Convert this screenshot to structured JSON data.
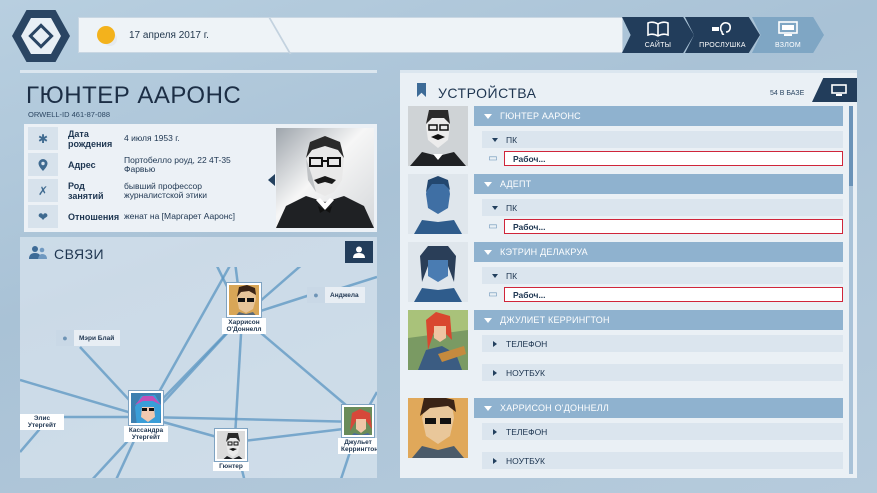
{
  "topbar": {
    "date": "17 апреля 2017 г.",
    "nav": [
      {
        "label": "САЙТЫ",
        "icon": "book-icon"
      },
      {
        "label": "ПРОСЛУШКА",
        "icon": "ear-icon"
      },
      {
        "label": "ВЗЛОМ",
        "icon": "computer-icon"
      }
    ]
  },
  "profile": {
    "name": "ГЮНТЕР ААРОНС",
    "orwell_id": "ORWELL-ID  461-87-088",
    "rows": [
      {
        "label": "Дата рождения",
        "value": "4 июля 1953 г."
      },
      {
        "label": "Адрес",
        "value": "Портобелло роуд, 22 4T-35 Фарвью"
      },
      {
        "label": "Род занятий",
        "value": "бывший профессор журналистской этики"
      },
      {
        "label": "Отношения",
        "value": "женат на [Маргарет Ааронс]"
      }
    ]
  },
  "links": {
    "title": "СВЯЗИ",
    "nodes": [
      {
        "name": "Харрисон О'Доннелл"
      },
      {
        "name": "Кассандра Утергейт"
      },
      {
        "name": "Гюнтер"
      },
      {
        "name": "Джульет Керрингтон"
      }
    ],
    "tags": [
      {
        "name": "Анджела"
      },
      {
        "name": "Мэри Блай"
      },
      {
        "name": "Элис Утергейт"
      }
    ]
  },
  "devices": {
    "title": "УСТРОЙСТВА",
    "count": "54 В БАЗЕ",
    "people": [
      {
        "name": "ГЮНТЕР ААРОНС",
        "devices": [
          {
            "type": "ПК",
            "field": "Рабоч..."
          }
        ]
      },
      {
        "name": "АДЕПТ",
        "devices": [
          {
            "type": "ПК",
            "field": "Рабоч..."
          }
        ]
      },
      {
        "name": "КЭТРИН ДЕЛАКРУА",
        "devices": [
          {
            "type": "ПК",
            "field": "Рабоч..."
          }
        ]
      },
      {
        "name": "ДЖУЛИЕТ КЕРРИНГТОН",
        "devices": [
          {
            "type": "ТЕЛЕФОН"
          },
          {
            "type": "НОУТБУК"
          }
        ]
      },
      {
        "name": "ХАРРИСОН О'ДОННЕЛЛ",
        "devices": [
          {
            "type": "ТЕЛЕФОН"
          },
          {
            "type": "НОУТБУК"
          }
        ]
      }
    ]
  }
}
